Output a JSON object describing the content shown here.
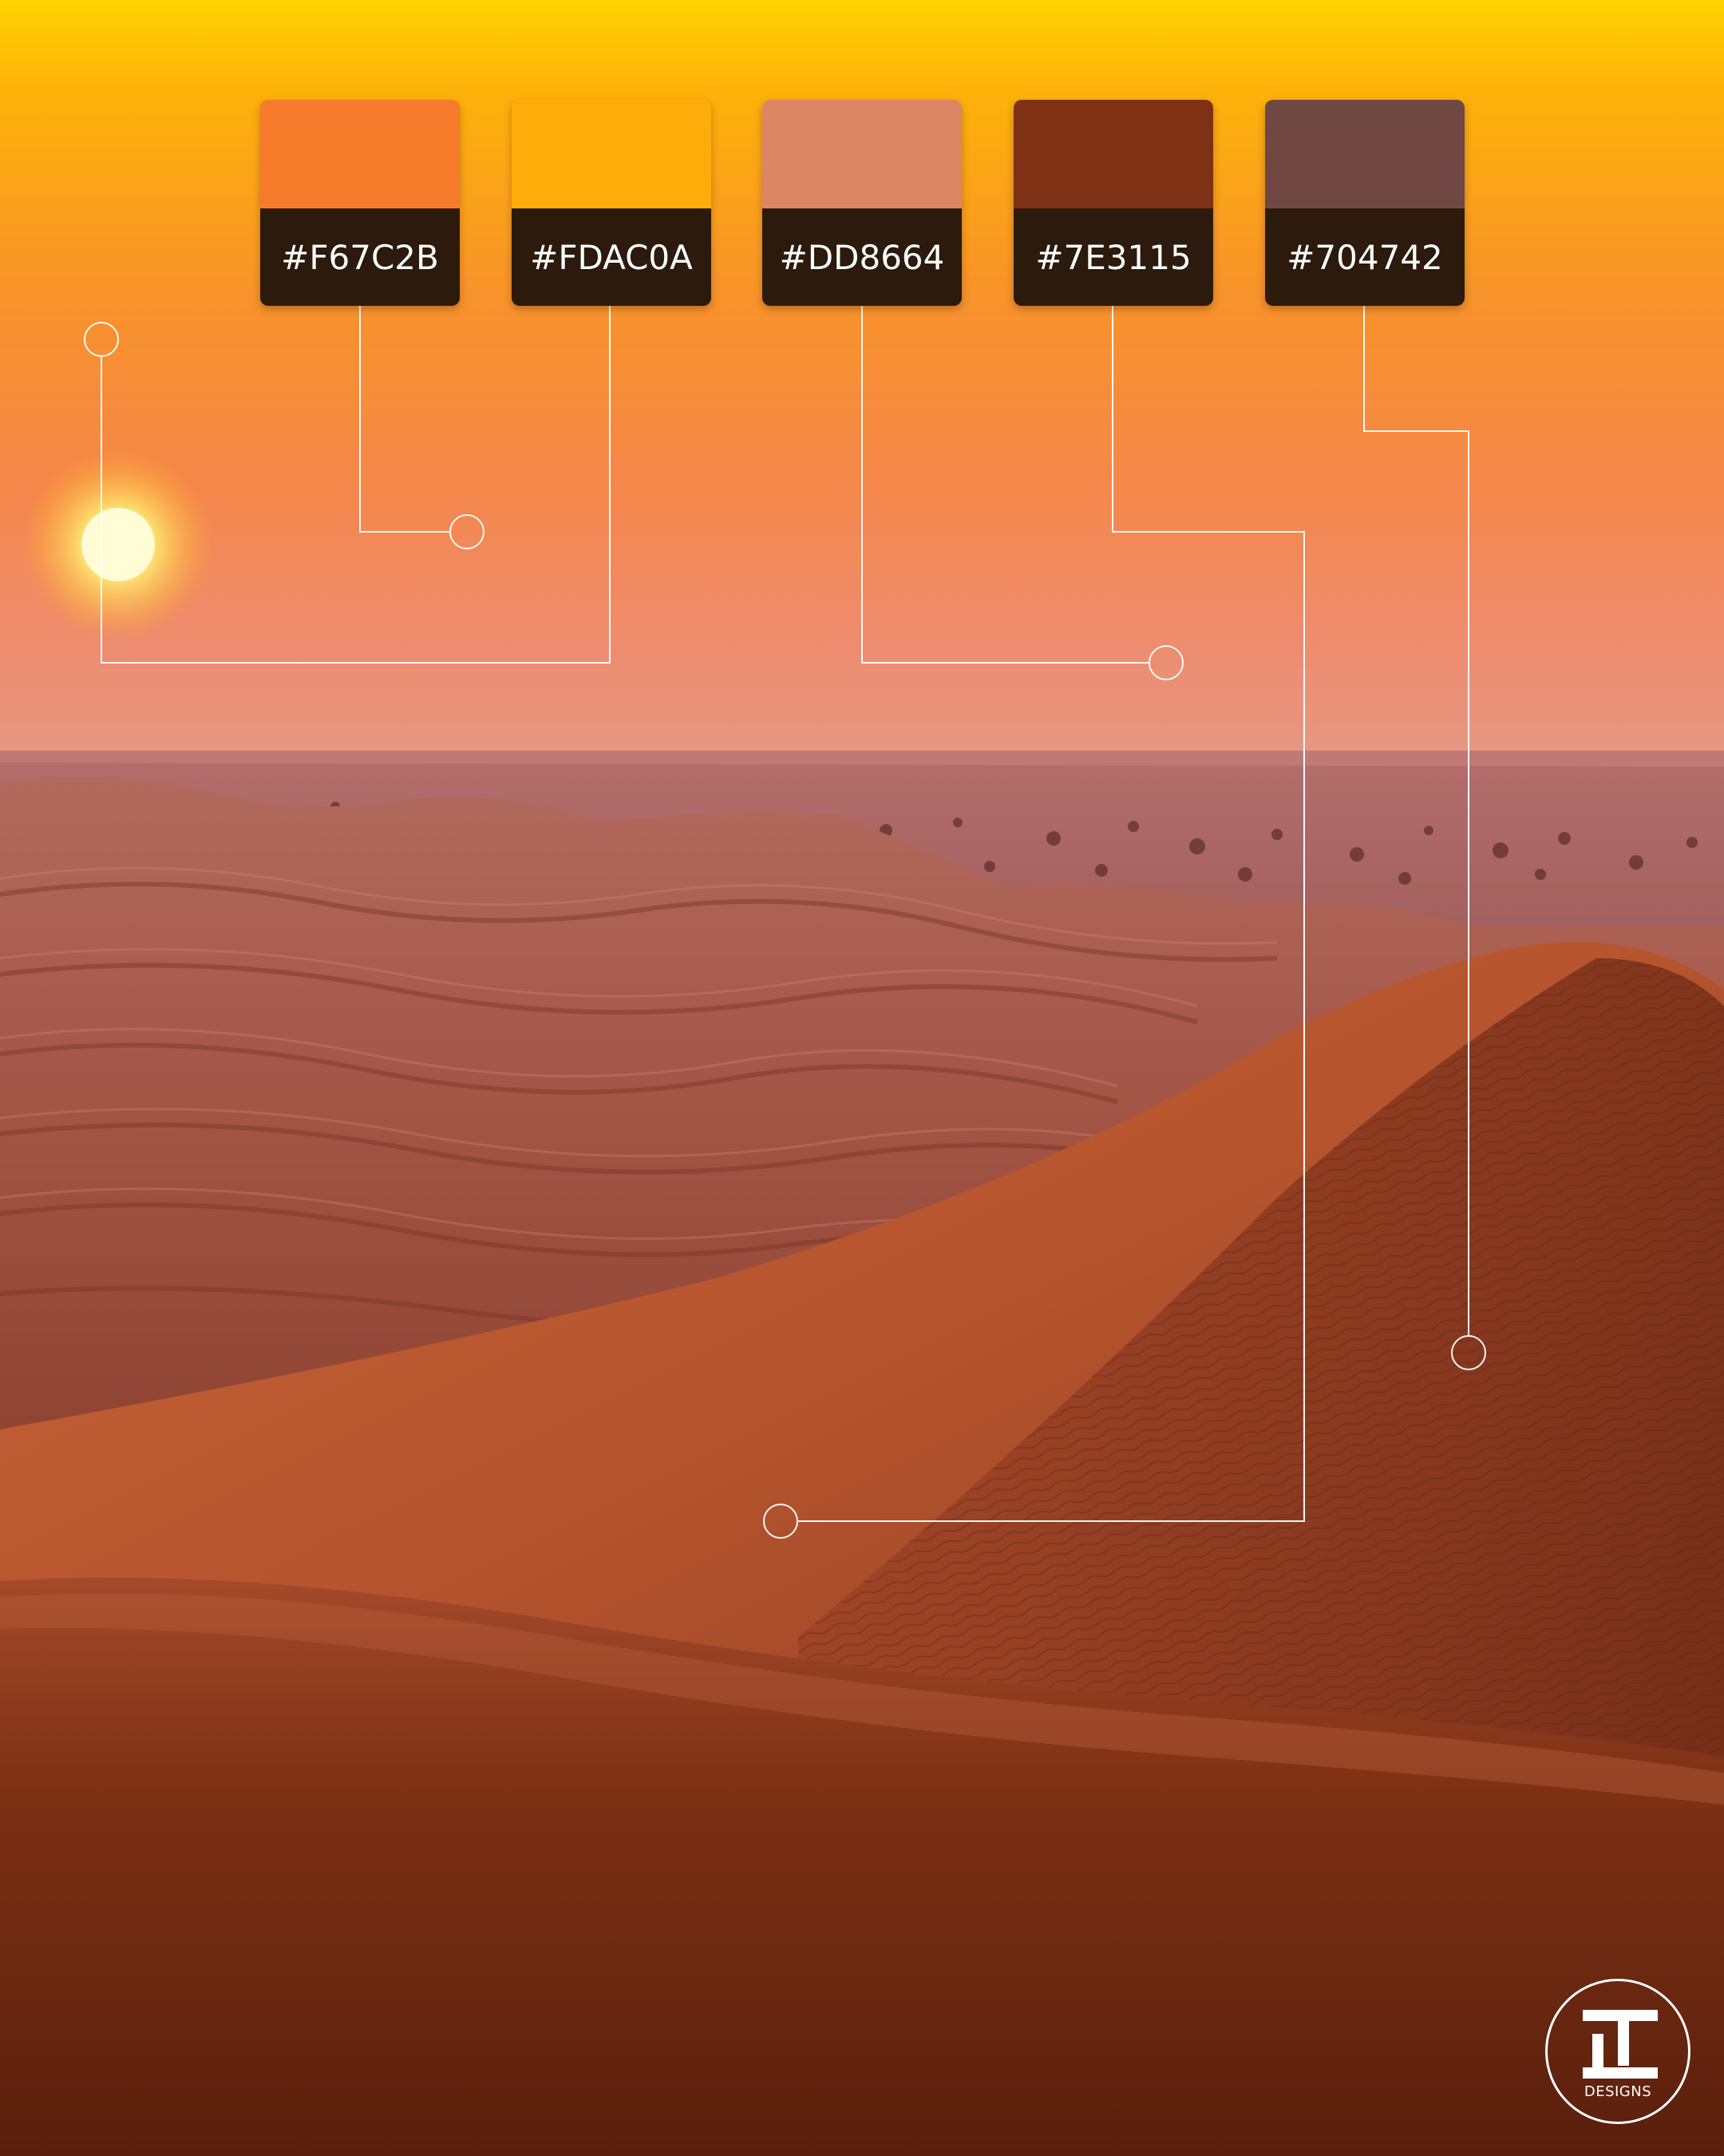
{
  "palette": {
    "swatches": [
      {
        "hex": "#F67C2B",
        "label": "#F67C2B"
      },
      {
        "hex": "#FDAC0A",
        "label": "#FDAC0A"
      },
      {
        "hex": "#DD8664",
        "label": "#DD8664"
      },
      {
        "hex": "#7E3115",
        "label": "#7E3115"
      },
      {
        "hex": "#704742",
        "label": "#704742"
      }
    ]
  },
  "logo": {
    "text": "DESIGNS"
  }
}
